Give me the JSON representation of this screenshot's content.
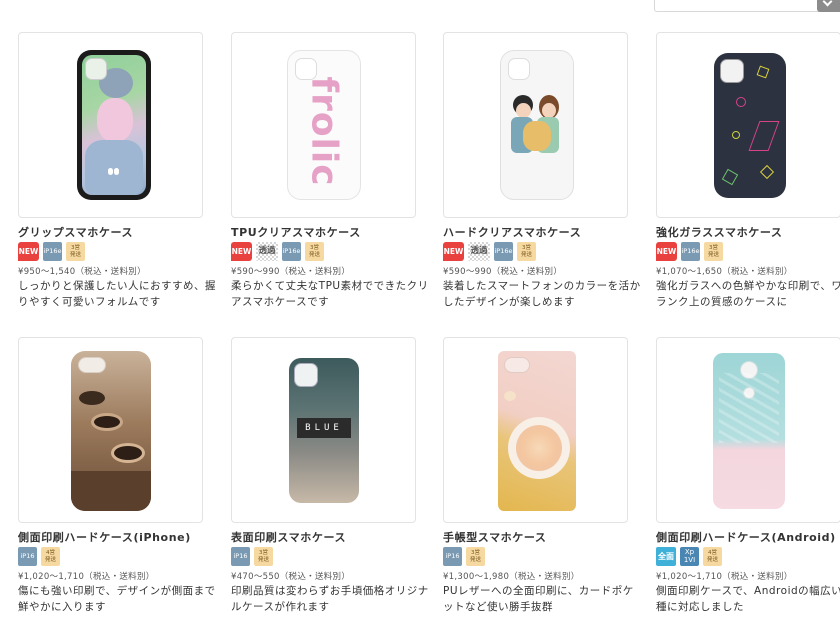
{
  "products": [
    {
      "title": "グリップスマホケース",
      "badges": [
        {
          "type": "new",
          "text": "NEW"
        },
        {
          "type": "ip",
          "text": "iP16e"
        },
        {
          "type": "ship",
          "text": "3営\n発送"
        }
      ],
      "price": "¥950〜1,540（税込・送料別）",
      "desc": "しっかりと保護したい人におすすめ、握りやすく可愛いフォルムです"
    },
    {
      "title": "TPUクリアスマホケース",
      "case_text": "frolic",
      "badges": [
        {
          "type": "new",
          "text": "NEW"
        },
        {
          "type": "toumei",
          "text": "透過"
        },
        {
          "type": "ip",
          "text": "iP16e"
        },
        {
          "type": "ship",
          "text": "3営\n発送"
        }
      ],
      "price": "¥590〜990（税込・送料別）",
      "desc": "柔らかくて丈夫なTPU素材でできたクリアスマホケースです"
    },
    {
      "title": "ハードクリアスマホケース",
      "badges": [
        {
          "type": "new",
          "text": "NEW"
        },
        {
          "type": "toumei",
          "text": "透過"
        },
        {
          "type": "ip",
          "text": "iP16e"
        },
        {
          "type": "ship",
          "text": "3営\n発送"
        }
      ],
      "price": "¥590〜990（税込・送料別）",
      "desc": "装着したスマートフォンのカラーを活かしたデザインが楽しめます"
    },
    {
      "title": "強化ガラススマホケース",
      "badges": [
        {
          "type": "new",
          "text": "NEW"
        },
        {
          "type": "ip",
          "text": "iP16e"
        },
        {
          "type": "ship",
          "text": "3営\n発送"
        }
      ],
      "price": "¥1,070〜1,650（税込・送料別）",
      "desc": "強化ガラスへの色鮮やかな印刷で、ワンランク上の質感のケースに"
    },
    {
      "title": "側面印刷ハードケース(iPhone)",
      "badges": [
        {
          "type": "ip",
          "text": "iP16"
        },
        {
          "type": "ship",
          "text": "4営\n発送"
        }
      ],
      "price": "¥1,020〜1,710（税込・送料別）",
      "desc": "傷にも強い印刷で、デザインが側面まで鮮やかに入ります"
    },
    {
      "title": "表面印刷スマホケース",
      "case_text": "BLUE",
      "badges": [
        {
          "type": "ip",
          "text": "iP16"
        },
        {
          "type": "ship",
          "text": "3営\n発送"
        }
      ],
      "price": "¥470〜550（税込・送料別）",
      "desc": "印刷品質は変わらずお手頃価格オリジナルケースが作れます"
    },
    {
      "title": "手帳型スマホケース",
      "badges": [
        {
          "type": "ip",
          "text": "iP16"
        },
        {
          "type": "ship",
          "text": "3営\n発送"
        }
      ],
      "price": "¥1,300〜1,980（税込・送料別）",
      "desc": "PUレザーへの全面印刷に、カードポケットなど使い勝手抜群"
    },
    {
      "title": "側面印刷ハードケース(Android)",
      "badges": [
        {
          "type": "zenmen",
          "text": "全面"
        },
        {
          "type": "xp",
          "text": "Xp\n1VI"
        },
        {
          "type": "ship",
          "text": "4営\n発送"
        }
      ],
      "price": "¥1,020〜1,710（税込・送料別）",
      "desc": "側面印刷ケースで、Androidの幅広い機種に対応しました"
    }
  ]
}
